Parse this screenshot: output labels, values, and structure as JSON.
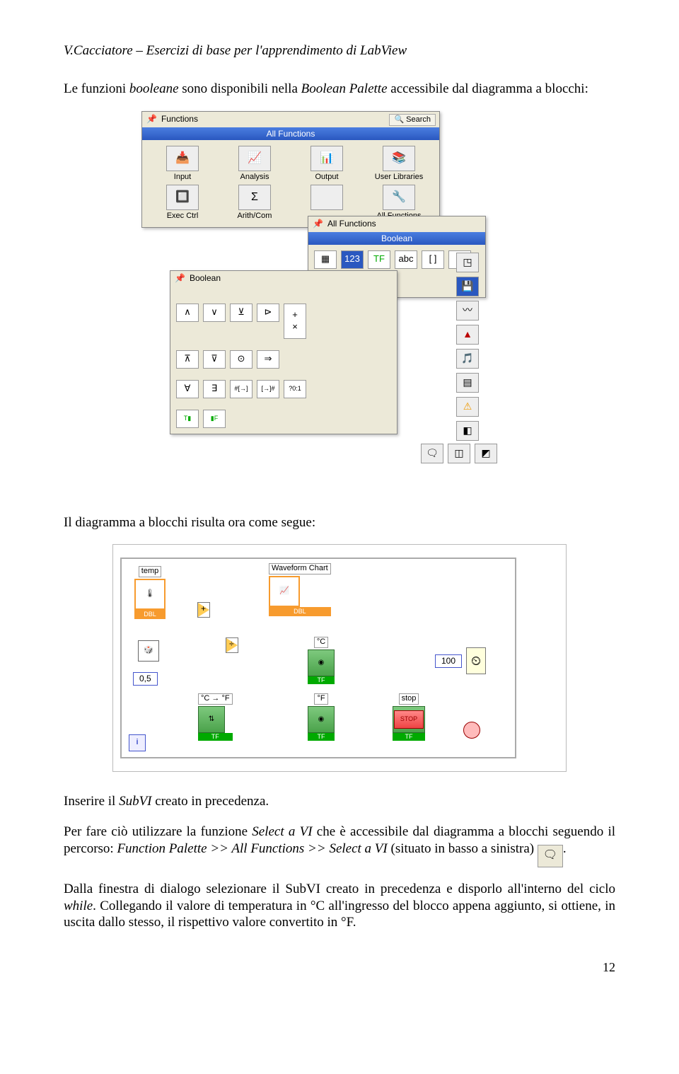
{
  "header": "V.Cacciatore – Esercizi di base per l'apprendimento di LabView",
  "intro_a": "Le funzioni ",
  "intro_b": "booleane",
  "intro_c": " sono disponibili nella ",
  "intro_d": "Boolean Palette",
  "intro_e": " accessibile dal diagramma a blocchi:",
  "palette": {
    "functions_title": "Functions",
    "search": "Search",
    "all_functions_bar": "All Functions",
    "items": [
      {
        "label": "Input"
      },
      {
        "label": "Analysis"
      },
      {
        "label": "Output"
      },
      {
        "label": "User Libraries"
      },
      {
        "label": "Exec Ctrl"
      },
      {
        "label": "Arith/Com"
      },
      {
        "label": ""
      },
      {
        "label": "All Functions"
      }
    ],
    "sub_title": "All Functions",
    "sub_bar": "Boolean",
    "boolean_title": "Boolean"
  },
  "mid_text": "Il diagramma a blocchi risulta ora come segue:",
  "diagram": {
    "temp": "temp",
    "chart": "Waveform Chart",
    "plus": "+",
    "div": "÷",
    "half": "0,5",
    "degC": "°C",
    "degF": "°F",
    "cf": "°C → °F",
    "hundred": "100",
    "stop": "stop",
    "stopbtn": "STOP",
    "dbl": "DBL",
    "tf": "TF",
    "i": "i"
  },
  "p2_a": "Inserire il ",
  "p2_b": "SubVI",
  "p2_c": " creato in precedenza.",
  "p3_a": "Per fare ciò utilizzare la funzione ",
  "p3_b": "Select a VI",
  "p3_c": " che è accessibile dal diagramma a blocchi seguendo il percorso: ",
  "p3_d": "Function Palette >> All Functions >> Select a VI",
  "p3_e": " (situato in basso a sinistra) ",
  "p3_f": ".",
  "p4_a": "Dalla finestra di dialogo selezionare il SubVI creato in precedenza e disporlo all'interno del ciclo ",
  "p4_b": "while",
  "p4_c": ". Collegando il valore di temperatura in °C all'ingresso del blocco appena aggiunto, si ottiene, in uscita dallo stesso, il rispettivo valore convertito in °F.",
  "pagenum": "12",
  "icons": {
    "pin": "📌",
    "search": "🔍",
    "selectvi": "🗨",
    "metro": "⏲"
  }
}
